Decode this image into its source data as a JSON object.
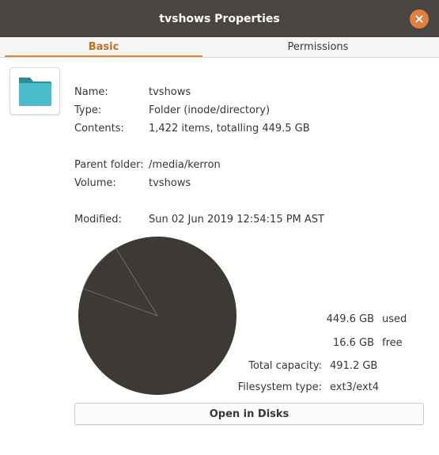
{
  "window": {
    "title": "tvshows Properties",
    "close_label": "×"
  },
  "tabs": [
    {
      "label": "Basic"
    },
    {
      "label": "Permissions"
    }
  ],
  "info": {
    "name_label": "Name:",
    "name": "tvshows",
    "type_label": "Type:",
    "type": "Folder (inode/directory)",
    "contents_label": "Contents:",
    "contents": "1,422 items, totalling 449.5 GB",
    "parent_label": "Parent folder:",
    "parent": "/media/kerron",
    "volume_label": "Volume:",
    "volume": "tvshows",
    "modified_label": "Modified:",
    "modified": "Sun 02 Jun 2019 12:54:15 PM AST"
  },
  "usage": {
    "used_value": "449.6 GB",
    "used_label": "used",
    "free_value": "16.6 GB",
    "free_label": "free",
    "capacity_label": "Total capacity:",
    "capacity_value": "491.2 GB",
    "fstype_label": "Filesystem type:",
    "fstype_value": "ext3/ext4",
    "used_gb": 449.6,
    "free_gb": 16.6,
    "colors": {
      "used": "#3d3935",
      "free": "#3d3935",
      "divider": "#7d7670"
    }
  },
  "actions": {
    "open_disks": "Open in Disks"
  },
  "colors": {
    "accent": "#e0813f",
    "folder": "#4bbcca",
    "folder_dark": "#2a8c99",
    "titlebar": "#4a4541"
  }
}
